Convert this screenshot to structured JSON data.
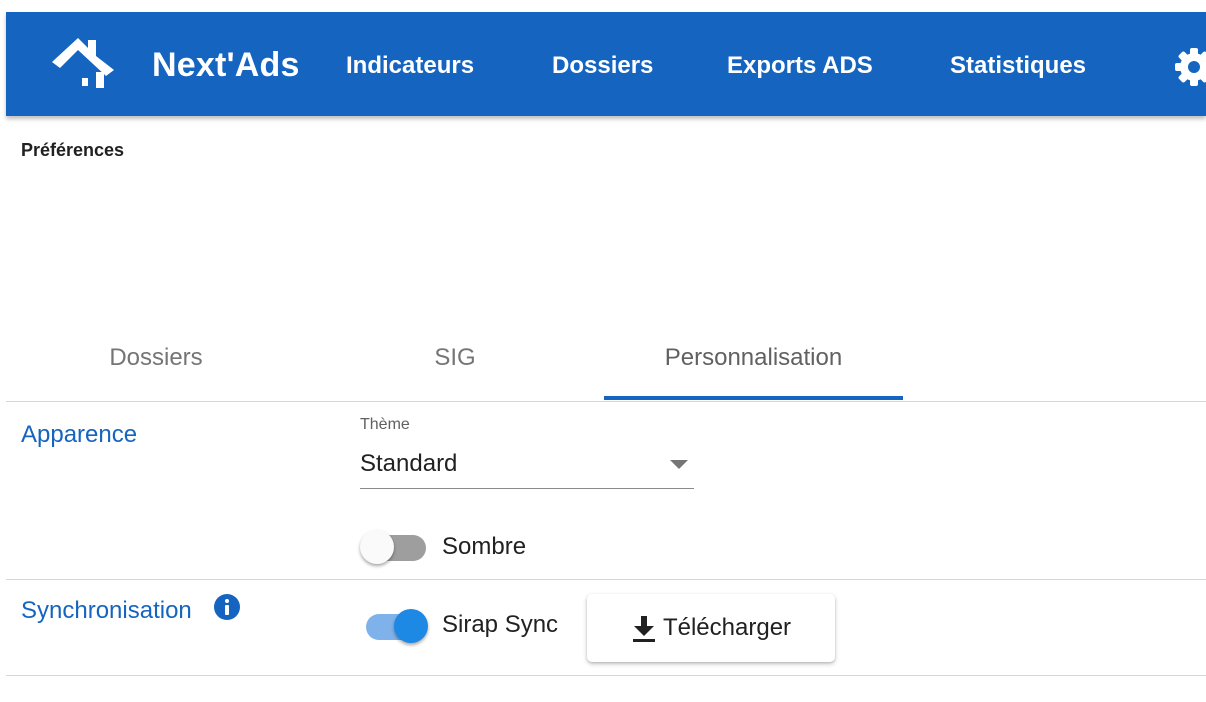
{
  "app": {
    "brand": "Next'Ads",
    "logo_icon": "house-logo-icon",
    "colors": {
      "primary": "#1565c0",
      "accent": "#1e88e5"
    }
  },
  "nav": {
    "items": [
      {
        "label": "Indicateurs"
      },
      {
        "label": "Dossiers"
      },
      {
        "label": "Exports ADS"
      },
      {
        "label": "Statistiques"
      }
    ],
    "settings_icon": "gear-icon"
  },
  "page": {
    "title": "Préférences"
  },
  "tabs": {
    "items": [
      {
        "label": "Dossiers",
        "active": false
      },
      {
        "label": "SIG",
        "active": false
      },
      {
        "label": "Personnalisation",
        "active": true
      }
    ]
  },
  "appearance": {
    "label": "Apparence",
    "theme": {
      "label": "Thème",
      "value": "Standard"
    },
    "dark_mode": {
      "label": "Sombre",
      "enabled": false
    }
  },
  "sync": {
    "label": "Synchronisation",
    "info_icon": "info-icon",
    "toggle": {
      "label": "Sirap Sync",
      "enabled": true
    },
    "download_button": {
      "label": "Télécharger",
      "icon": "download-icon"
    }
  }
}
